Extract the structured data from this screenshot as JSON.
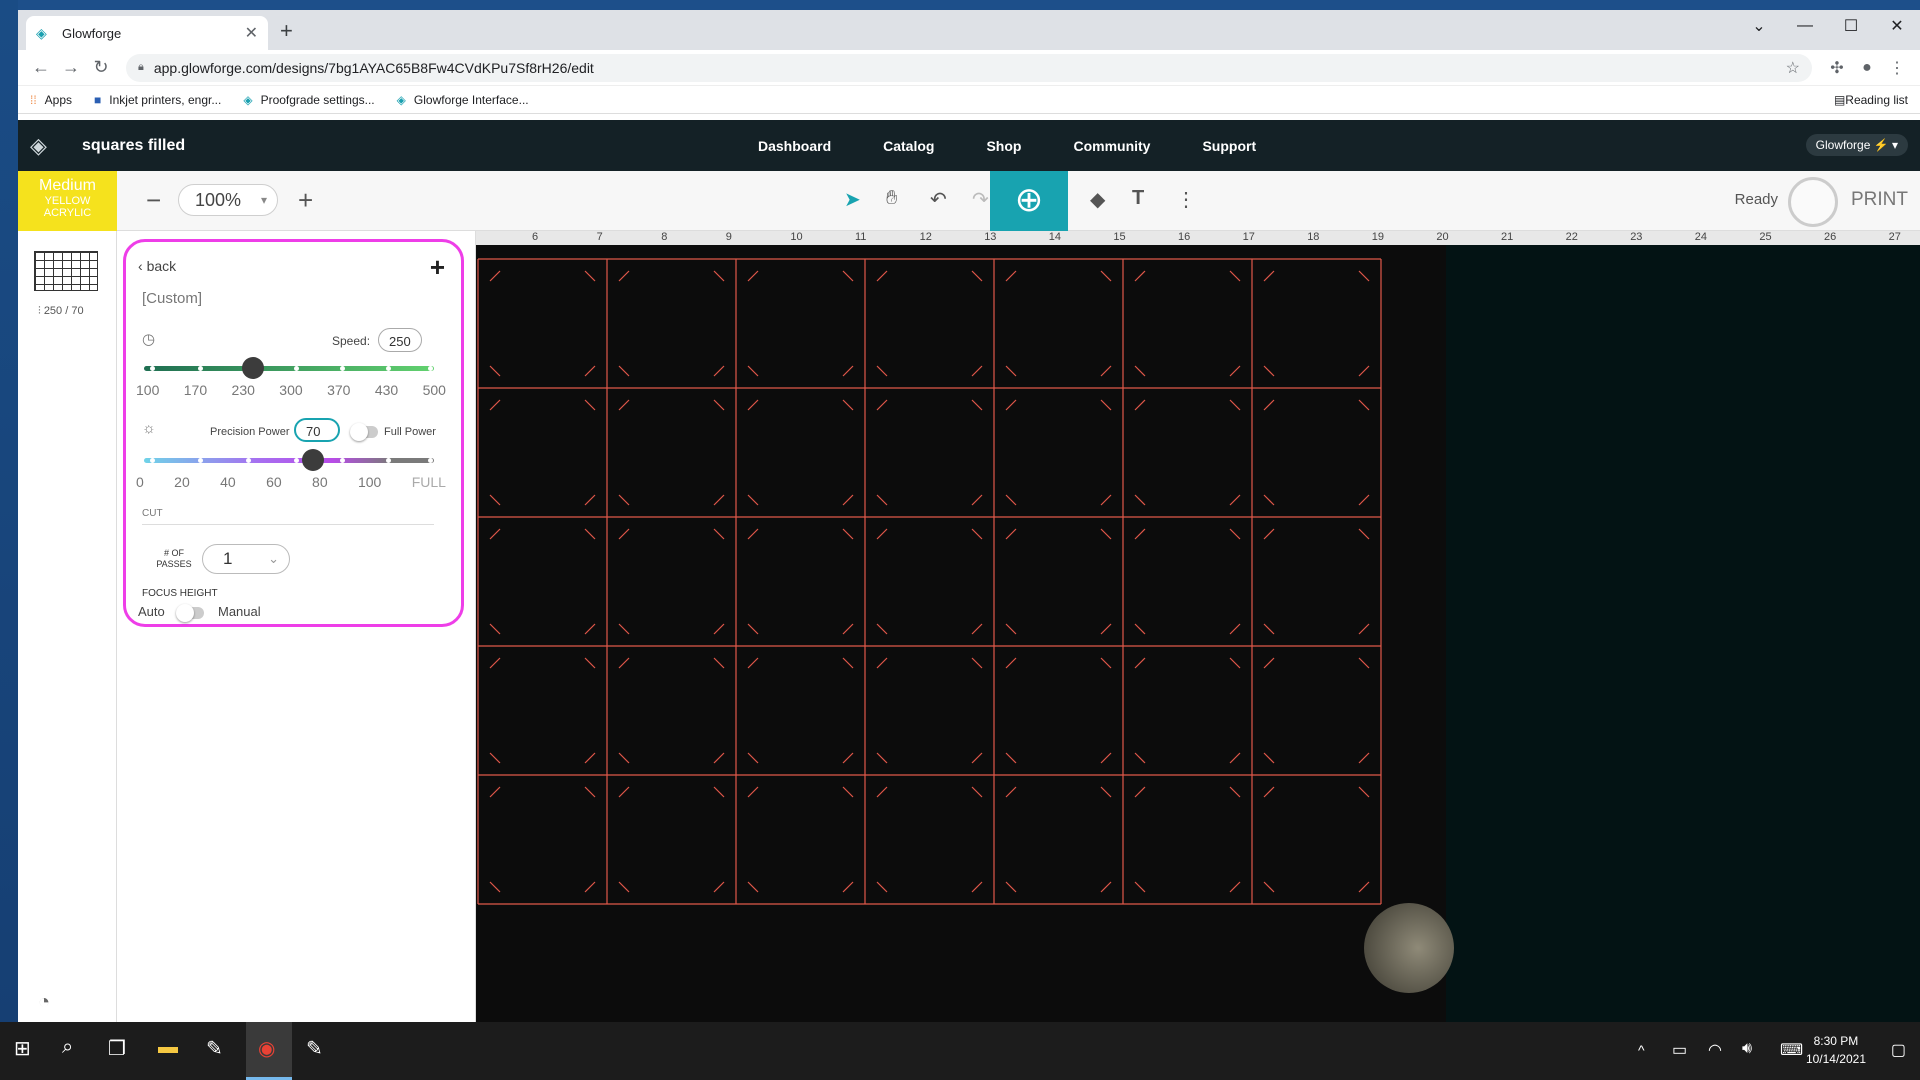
{
  "browser": {
    "tab_title": "Glowforge",
    "url": "app.glowforge.com/designs/7bg1AYAC65B8Fw4CVdKPu7Sf8rH26/edit",
    "bookmarks": [
      "Apps",
      "Inkjet printers, engr...",
      "Proofgrade settings...",
      "Glowforge Interface..."
    ],
    "reading_list": "Reading list"
  },
  "header": {
    "design_title": "squares filled",
    "nav": [
      "Dashboard",
      "Catalog",
      "Shop",
      "Community",
      "Support"
    ],
    "account": "Glowforge ⚡ ▾"
  },
  "toolbar": {
    "material_line1": "Medium",
    "material_line2": "Yellow",
    "material_line3": "Acrylic",
    "zoom": "100%",
    "status": "Ready",
    "print_label": "PRINT"
  },
  "thumbnail": {
    "setting": "250 / 70"
  },
  "settings": {
    "back_label": "back",
    "preset": "[Custom]",
    "speed_label": "Speed:",
    "speed_value": "250",
    "speed_fraction": 0.375,
    "speed_ticks": [
      "100",
      "170",
      "230",
      "300",
      "370",
      "430",
      "500"
    ],
    "power_label": "Precision Power",
    "power_value": "70",
    "power_fraction": 0.583,
    "full_power_label": "Full Power",
    "power_ticks": [
      "0",
      "20",
      "40",
      "60",
      "80",
      "100",
      "FULL"
    ],
    "cut_section": "CUT",
    "passes_label": "# OF PASSES",
    "passes_value": "1",
    "focus_label": "FOCUS HEIGHT",
    "focus_auto": "Auto",
    "focus_manual": "Manual"
  },
  "ruler": [
    "6",
    "7",
    "8",
    "9",
    "10",
    "11",
    "12",
    "13",
    "14",
    "15",
    "16",
    "17",
    "18",
    "19",
    "20",
    "21",
    "22",
    "23",
    "24",
    "25",
    "26",
    "27"
  ],
  "taskbar": {
    "time": "8:30 PM",
    "date": "10/14/2021"
  }
}
